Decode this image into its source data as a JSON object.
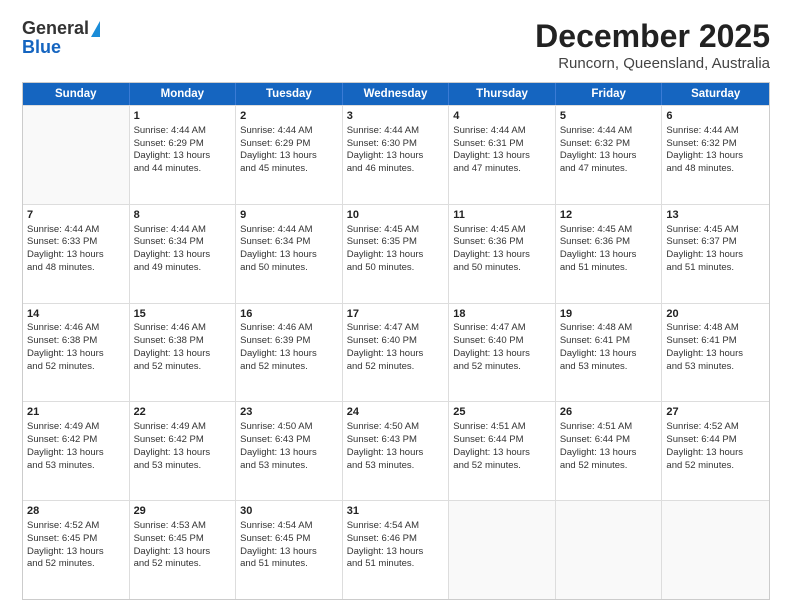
{
  "header": {
    "logo_general": "General",
    "logo_blue": "Blue",
    "title": "December 2025",
    "subtitle": "Runcorn, Queensland, Australia"
  },
  "days_of_week": [
    "Sunday",
    "Monday",
    "Tuesday",
    "Wednesday",
    "Thursday",
    "Friday",
    "Saturday"
  ],
  "weeks": [
    [
      {
        "day": "",
        "sunrise": "",
        "sunset": "",
        "daylight": "",
        "empty": true
      },
      {
        "day": "1",
        "sunrise": "Sunrise: 4:44 AM",
        "sunset": "Sunset: 6:29 PM",
        "daylight": "Daylight: 13 hours and 44 minutes."
      },
      {
        "day": "2",
        "sunrise": "Sunrise: 4:44 AM",
        "sunset": "Sunset: 6:29 PM",
        "daylight": "Daylight: 13 hours and 45 minutes."
      },
      {
        "day": "3",
        "sunrise": "Sunrise: 4:44 AM",
        "sunset": "Sunset: 6:30 PM",
        "daylight": "Daylight: 13 hours and 46 minutes."
      },
      {
        "day": "4",
        "sunrise": "Sunrise: 4:44 AM",
        "sunset": "Sunset: 6:31 PM",
        "daylight": "Daylight: 13 hours and 47 minutes."
      },
      {
        "day": "5",
        "sunrise": "Sunrise: 4:44 AM",
        "sunset": "Sunset: 6:32 PM",
        "daylight": "Daylight: 13 hours and 47 minutes."
      },
      {
        "day": "6",
        "sunrise": "Sunrise: 4:44 AM",
        "sunset": "Sunset: 6:32 PM",
        "daylight": "Daylight: 13 hours and 48 minutes."
      }
    ],
    [
      {
        "day": "7",
        "sunrise": "Sunrise: 4:44 AM",
        "sunset": "Sunset: 6:33 PM",
        "daylight": "Daylight: 13 hours and 48 minutes."
      },
      {
        "day": "8",
        "sunrise": "Sunrise: 4:44 AM",
        "sunset": "Sunset: 6:34 PM",
        "daylight": "Daylight: 13 hours and 49 minutes."
      },
      {
        "day": "9",
        "sunrise": "Sunrise: 4:44 AM",
        "sunset": "Sunset: 6:34 PM",
        "daylight": "Daylight: 13 hours and 50 minutes."
      },
      {
        "day": "10",
        "sunrise": "Sunrise: 4:45 AM",
        "sunset": "Sunset: 6:35 PM",
        "daylight": "Daylight: 13 hours and 50 minutes."
      },
      {
        "day": "11",
        "sunrise": "Sunrise: 4:45 AM",
        "sunset": "Sunset: 6:36 PM",
        "daylight": "Daylight: 13 hours and 50 minutes."
      },
      {
        "day": "12",
        "sunrise": "Sunrise: 4:45 AM",
        "sunset": "Sunset: 6:36 PM",
        "daylight": "Daylight: 13 hours and 51 minutes."
      },
      {
        "day": "13",
        "sunrise": "Sunrise: 4:45 AM",
        "sunset": "Sunset: 6:37 PM",
        "daylight": "Daylight: 13 hours and 51 minutes."
      }
    ],
    [
      {
        "day": "14",
        "sunrise": "Sunrise: 4:46 AM",
        "sunset": "Sunset: 6:38 PM",
        "daylight": "Daylight: 13 hours and 52 minutes."
      },
      {
        "day": "15",
        "sunrise": "Sunrise: 4:46 AM",
        "sunset": "Sunset: 6:38 PM",
        "daylight": "Daylight: 13 hours and 52 minutes."
      },
      {
        "day": "16",
        "sunrise": "Sunrise: 4:46 AM",
        "sunset": "Sunset: 6:39 PM",
        "daylight": "Daylight: 13 hours and 52 minutes."
      },
      {
        "day": "17",
        "sunrise": "Sunrise: 4:47 AM",
        "sunset": "Sunset: 6:40 PM",
        "daylight": "Daylight: 13 hours and 52 minutes."
      },
      {
        "day": "18",
        "sunrise": "Sunrise: 4:47 AM",
        "sunset": "Sunset: 6:40 PM",
        "daylight": "Daylight: 13 hours and 52 minutes."
      },
      {
        "day": "19",
        "sunrise": "Sunrise: 4:48 AM",
        "sunset": "Sunset: 6:41 PM",
        "daylight": "Daylight: 13 hours and 53 minutes."
      },
      {
        "day": "20",
        "sunrise": "Sunrise: 4:48 AM",
        "sunset": "Sunset: 6:41 PM",
        "daylight": "Daylight: 13 hours and 53 minutes."
      }
    ],
    [
      {
        "day": "21",
        "sunrise": "Sunrise: 4:49 AM",
        "sunset": "Sunset: 6:42 PM",
        "daylight": "Daylight: 13 hours and 53 minutes."
      },
      {
        "day": "22",
        "sunrise": "Sunrise: 4:49 AM",
        "sunset": "Sunset: 6:42 PM",
        "daylight": "Daylight: 13 hours and 53 minutes."
      },
      {
        "day": "23",
        "sunrise": "Sunrise: 4:50 AM",
        "sunset": "Sunset: 6:43 PM",
        "daylight": "Daylight: 13 hours and 53 minutes."
      },
      {
        "day": "24",
        "sunrise": "Sunrise: 4:50 AM",
        "sunset": "Sunset: 6:43 PM",
        "daylight": "Daylight: 13 hours and 53 minutes."
      },
      {
        "day": "25",
        "sunrise": "Sunrise: 4:51 AM",
        "sunset": "Sunset: 6:44 PM",
        "daylight": "Daylight: 13 hours and 52 minutes."
      },
      {
        "day": "26",
        "sunrise": "Sunrise: 4:51 AM",
        "sunset": "Sunset: 6:44 PM",
        "daylight": "Daylight: 13 hours and 52 minutes."
      },
      {
        "day": "27",
        "sunrise": "Sunrise: 4:52 AM",
        "sunset": "Sunset: 6:44 PM",
        "daylight": "Daylight: 13 hours and 52 minutes."
      }
    ],
    [
      {
        "day": "28",
        "sunrise": "Sunrise: 4:52 AM",
        "sunset": "Sunset: 6:45 PM",
        "daylight": "Daylight: 13 hours and 52 minutes."
      },
      {
        "day": "29",
        "sunrise": "Sunrise: 4:53 AM",
        "sunset": "Sunset: 6:45 PM",
        "daylight": "Daylight: 13 hours and 52 minutes."
      },
      {
        "day": "30",
        "sunrise": "Sunrise: 4:54 AM",
        "sunset": "Sunset: 6:45 PM",
        "daylight": "Daylight: 13 hours and 51 minutes."
      },
      {
        "day": "31",
        "sunrise": "Sunrise: 4:54 AM",
        "sunset": "Sunset: 6:46 PM",
        "daylight": "Daylight: 13 hours and 51 minutes."
      },
      {
        "day": "",
        "sunrise": "",
        "sunset": "",
        "daylight": "",
        "empty": true
      },
      {
        "day": "",
        "sunrise": "",
        "sunset": "",
        "daylight": "",
        "empty": true
      },
      {
        "day": "",
        "sunrise": "",
        "sunset": "",
        "daylight": "",
        "empty": true
      }
    ]
  ]
}
